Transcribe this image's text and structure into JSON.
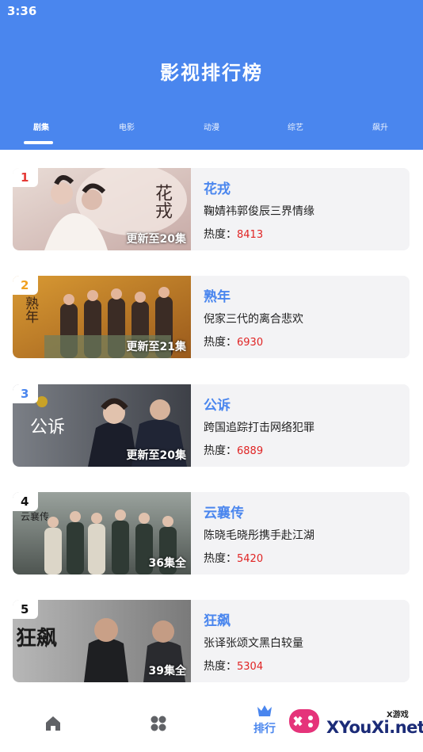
{
  "status_bar": {
    "time": "3:36"
  },
  "header": {
    "title": "影视排行榜"
  },
  "tabs": [
    {
      "label": "剧集",
      "active": true
    },
    {
      "label": "电影",
      "active": false
    },
    {
      "label": "动漫",
      "active": false
    },
    {
      "label": "综艺",
      "active": false
    },
    {
      "label": "飙升",
      "active": false
    }
  ],
  "heat_label": "热度：",
  "items": [
    {
      "rank": "1",
      "rank_color": "#e53935",
      "title": "花戎",
      "desc": "鞠婧祎郭俊辰三界情缘",
      "heat": "8413",
      "episodes": "更新至20集",
      "poster_text": "花戎",
      "poster_palette": "#d9c8c6"
    },
    {
      "rank": "2",
      "rank_color": "#f0a020",
      "title": "熟年",
      "desc": "倪家三代的离合悲欢",
      "heat": "6930",
      "episodes": "更新至21集",
      "poster_text": "熟年",
      "poster_palette": "#c98a2c"
    },
    {
      "rank": "3",
      "rank_color": "#4a86ee",
      "title": "公诉",
      "desc": "跨国追踪打击网络犯罪",
      "heat": "6889",
      "episodes": "更新至20集",
      "poster_text": "公诉",
      "poster_palette": "#55585e"
    },
    {
      "rank": "4",
      "rank_color": "#111111",
      "title": "云襄传",
      "desc": "陈晓毛晓彤携手赴江湖",
      "heat": "5420",
      "episodes": "36集全",
      "poster_text": "云襄传",
      "poster_palette": "#6d7470"
    },
    {
      "rank": "5",
      "rank_color": "#111111",
      "title": "狂飙",
      "desc": "张译张颂文黑白较量",
      "heat": "5304",
      "episodes": "39集全",
      "poster_text": "狂飙",
      "poster_palette": "#8e8e8e"
    }
  ],
  "bottom_nav": [
    {
      "icon": "home-icon",
      "label": ""
    },
    {
      "icon": "grid-icon",
      "label": ""
    },
    {
      "icon": "crown-icon",
      "label": "排行"
    }
  ],
  "watermark": {
    "brand": "XYouXi.net",
    "small": "X游戏"
  }
}
